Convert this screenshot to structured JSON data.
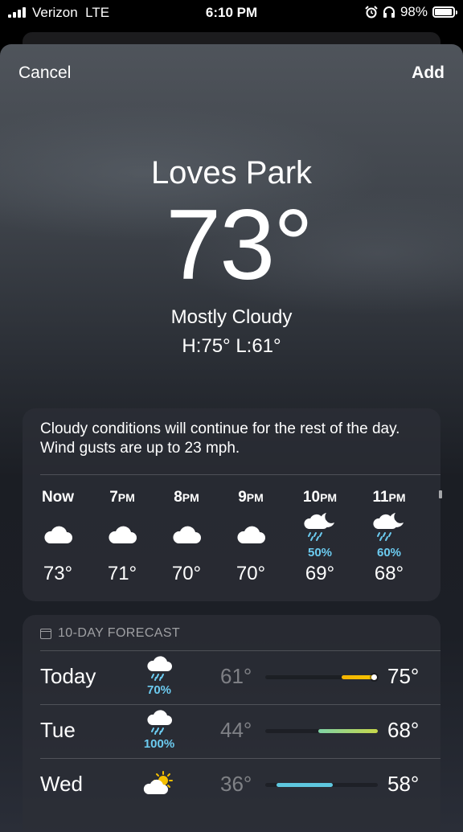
{
  "status_bar": {
    "carrier": "Verizon",
    "network": "LTE",
    "time": "6:10 PM",
    "battery": "98%"
  },
  "nav": {
    "cancel_label": "Cancel",
    "add_label": "Add"
  },
  "current": {
    "city": "Loves Park",
    "temperature": "73°",
    "condition": "Mostly Cloudy",
    "high_low": "H:75°  L:61°"
  },
  "hourly": {
    "summary": "Cloudy conditions will continue for the rest of the day. Wind gusts are up to 23 mph.",
    "items": [
      {
        "time": "Now",
        "period": "",
        "icon": "cloud-icon",
        "precip": "",
        "temp": "73°"
      },
      {
        "time": "7",
        "period": "PM",
        "icon": "cloud-icon",
        "precip": "",
        "temp": "71°"
      },
      {
        "time": "8",
        "period": "PM",
        "icon": "cloud-icon",
        "precip": "",
        "temp": "70°"
      },
      {
        "time": "9",
        "period": "PM",
        "icon": "cloud-icon",
        "precip": "",
        "temp": "70°"
      },
      {
        "time": "10",
        "period": "PM",
        "icon": "cloud-moon-rain-icon",
        "precip": "50%",
        "temp": "69°"
      },
      {
        "time": "11",
        "period": "PM",
        "icon": "cloud-moon-rain-icon",
        "precip": "60%",
        "temp": "68°"
      }
    ]
  },
  "daily": {
    "header": "10-DAY FORECAST",
    "days": [
      {
        "day": "Today",
        "icon": "cloud-rain-icon",
        "precip": "70%",
        "low": "61°",
        "high": "75°",
        "range": [
          0.68,
          0.98
        ],
        "colors": [
          "#f5b400",
          "#f5c400"
        ],
        "current_dot": true
      },
      {
        "day": "Tue",
        "icon": "cloud-rain-icon",
        "precip": "100%",
        "low": "44°",
        "high": "68°",
        "range": [
          0.47,
          1.0
        ],
        "colors": [
          "#7fd3a6",
          "#c7d84a"
        ],
        "current_dot": false
      },
      {
        "day": "Wed",
        "icon": "sun-cloud-icon",
        "precip": "",
        "low": "36°",
        "high": "58°",
        "range": [
          0.1,
          0.6
        ],
        "colors": [
          "#5ec7df",
          "#5ec7df"
        ],
        "current_dot": false
      }
    ]
  }
}
